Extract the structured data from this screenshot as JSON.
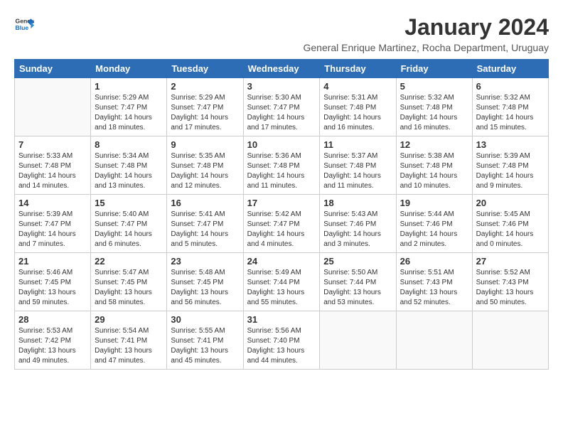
{
  "logo": {
    "general": "General",
    "blue": "Blue"
  },
  "header": {
    "month_title": "January 2024",
    "subtitle": "General Enrique Martinez, Rocha Department, Uruguay"
  },
  "weekdays": [
    "Sunday",
    "Monday",
    "Tuesday",
    "Wednesday",
    "Thursday",
    "Friday",
    "Saturday"
  ],
  "weeks": [
    [
      null,
      {
        "day": 1,
        "sunrise": "5:29 AM",
        "sunset": "7:47 PM",
        "daylight": "14 hours and 18 minutes."
      },
      {
        "day": 2,
        "sunrise": "5:29 AM",
        "sunset": "7:47 PM",
        "daylight": "14 hours and 17 minutes."
      },
      {
        "day": 3,
        "sunrise": "5:30 AM",
        "sunset": "7:47 PM",
        "daylight": "14 hours and 17 minutes."
      },
      {
        "day": 4,
        "sunrise": "5:31 AM",
        "sunset": "7:48 PM",
        "daylight": "14 hours and 16 minutes."
      },
      {
        "day": 5,
        "sunrise": "5:32 AM",
        "sunset": "7:48 PM",
        "daylight": "14 hours and 16 minutes."
      },
      {
        "day": 6,
        "sunrise": "5:32 AM",
        "sunset": "7:48 PM",
        "daylight": "14 hours and 15 minutes."
      }
    ],
    [
      {
        "day": 7,
        "sunrise": "5:33 AM",
        "sunset": "7:48 PM",
        "daylight": "14 hours and 14 minutes."
      },
      {
        "day": 8,
        "sunrise": "5:34 AM",
        "sunset": "7:48 PM",
        "daylight": "14 hours and 13 minutes."
      },
      {
        "day": 9,
        "sunrise": "5:35 AM",
        "sunset": "7:48 PM",
        "daylight": "14 hours and 12 minutes."
      },
      {
        "day": 10,
        "sunrise": "5:36 AM",
        "sunset": "7:48 PM",
        "daylight": "14 hours and 11 minutes."
      },
      {
        "day": 11,
        "sunrise": "5:37 AM",
        "sunset": "7:48 PM",
        "daylight": "14 hours and 11 minutes."
      },
      {
        "day": 12,
        "sunrise": "5:38 AM",
        "sunset": "7:48 PM",
        "daylight": "14 hours and 10 minutes."
      },
      {
        "day": 13,
        "sunrise": "5:39 AM",
        "sunset": "7:48 PM",
        "daylight": "14 hours and 9 minutes."
      }
    ],
    [
      {
        "day": 14,
        "sunrise": "5:39 AM",
        "sunset": "7:47 PM",
        "daylight": "14 hours and 7 minutes."
      },
      {
        "day": 15,
        "sunrise": "5:40 AM",
        "sunset": "7:47 PM",
        "daylight": "14 hours and 6 minutes."
      },
      {
        "day": 16,
        "sunrise": "5:41 AM",
        "sunset": "7:47 PM",
        "daylight": "14 hours and 5 minutes."
      },
      {
        "day": 17,
        "sunrise": "5:42 AM",
        "sunset": "7:47 PM",
        "daylight": "14 hours and 4 minutes."
      },
      {
        "day": 18,
        "sunrise": "5:43 AM",
        "sunset": "7:46 PM",
        "daylight": "14 hours and 3 minutes."
      },
      {
        "day": 19,
        "sunrise": "5:44 AM",
        "sunset": "7:46 PM",
        "daylight": "14 hours and 2 minutes."
      },
      {
        "day": 20,
        "sunrise": "5:45 AM",
        "sunset": "7:46 PM",
        "daylight": "14 hours and 0 minutes."
      }
    ],
    [
      {
        "day": 21,
        "sunrise": "5:46 AM",
        "sunset": "7:45 PM",
        "daylight": "13 hours and 59 minutes."
      },
      {
        "day": 22,
        "sunrise": "5:47 AM",
        "sunset": "7:45 PM",
        "daylight": "13 hours and 58 minutes."
      },
      {
        "day": 23,
        "sunrise": "5:48 AM",
        "sunset": "7:45 PM",
        "daylight": "13 hours and 56 minutes."
      },
      {
        "day": 24,
        "sunrise": "5:49 AM",
        "sunset": "7:44 PM",
        "daylight": "13 hours and 55 minutes."
      },
      {
        "day": 25,
        "sunrise": "5:50 AM",
        "sunset": "7:44 PM",
        "daylight": "13 hours and 53 minutes."
      },
      {
        "day": 26,
        "sunrise": "5:51 AM",
        "sunset": "7:43 PM",
        "daylight": "13 hours and 52 minutes."
      },
      {
        "day": 27,
        "sunrise": "5:52 AM",
        "sunset": "7:43 PM",
        "daylight": "13 hours and 50 minutes."
      }
    ],
    [
      {
        "day": 28,
        "sunrise": "5:53 AM",
        "sunset": "7:42 PM",
        "daylight": "13 hours and 49 minutes."
      },
      {
        "day": 29,
        "sunrise": "5:54 AM",
        "sunset": "7:41 PM",
        "daylight": "13 hours and 47 minutes."
      },
      {
        "day": 30,
        "sunrise": "5:55 AM",
        "sunset": "7:41 PM",
        "daylight": "13 hours and 45 minutes."
      },
      {
        "day": 31,
        "sunrise": "5:56 AM",
        "sunset": "7:40 PM",
        "daylight": "13 hours and 44 minutes."
      },
      null,
      null,
      null
    ]
  ]
}
